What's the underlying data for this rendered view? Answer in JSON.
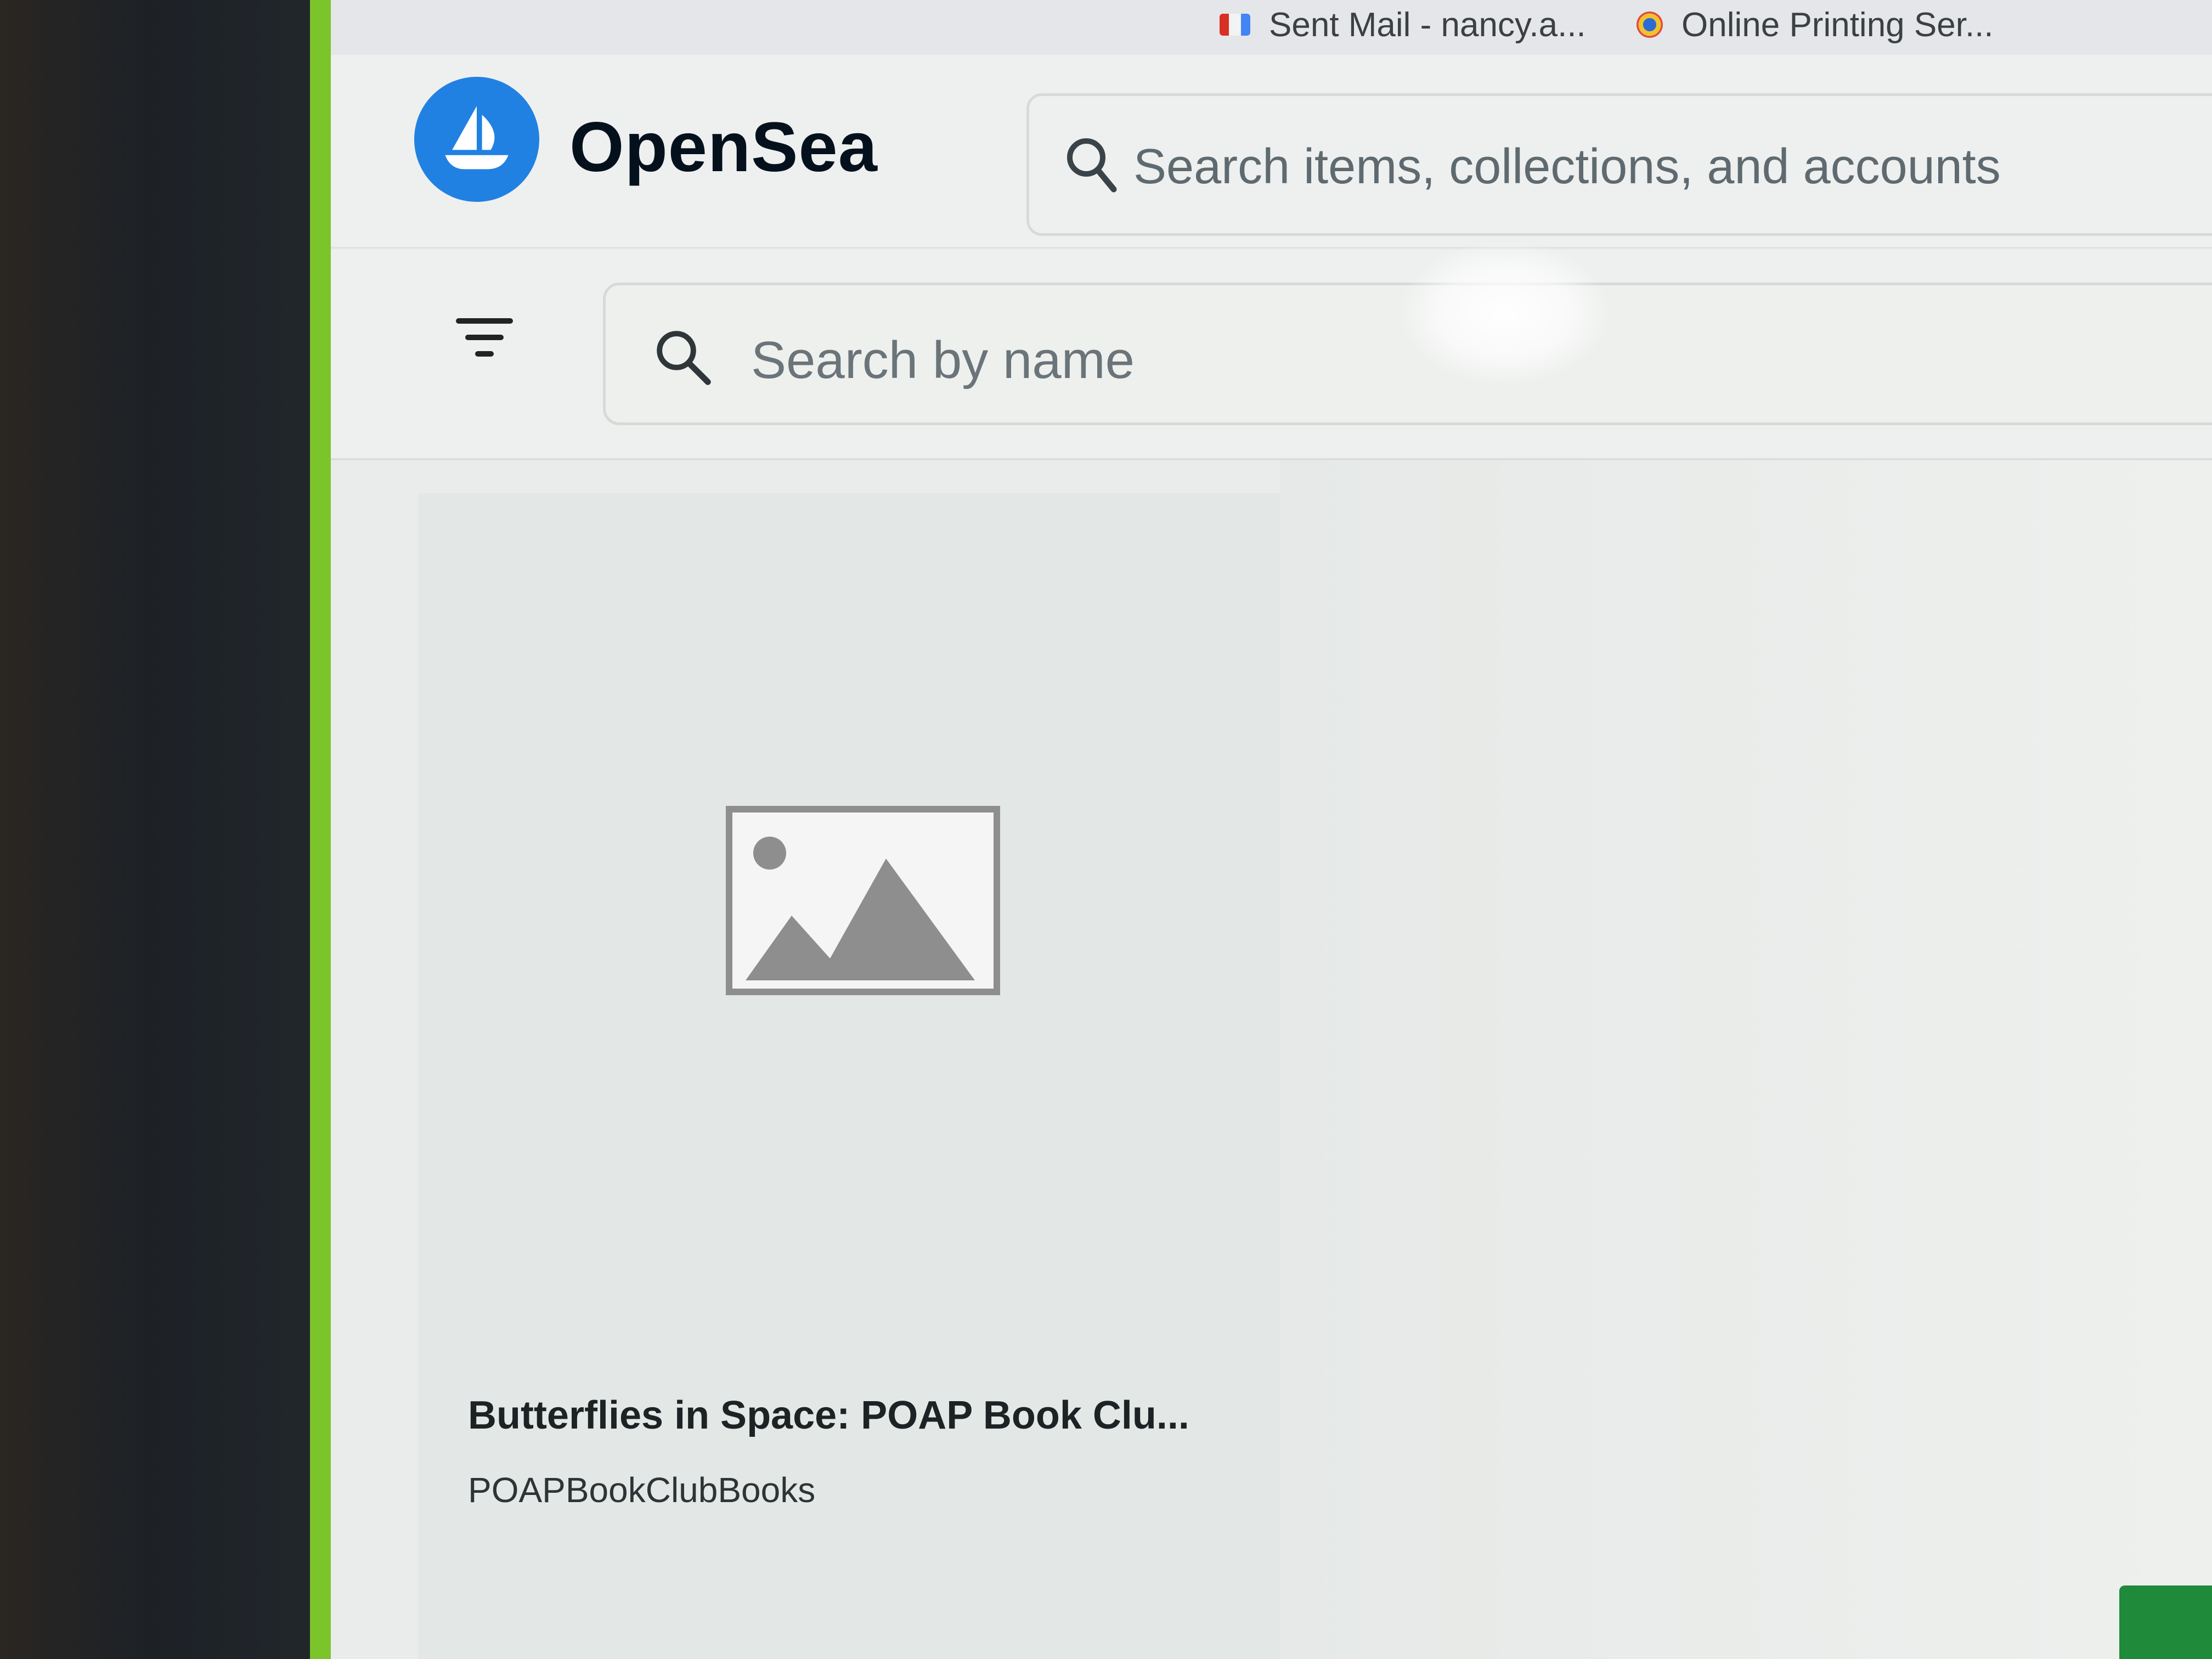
{
  "browser": {
    "bookmarks": [
      {
        "icon": "gmail-icon",
        "label": "Sent Mail - nancy.a..."
      },
      {
        "icon": "printing-service-icon",
        "label": "Online Printing Ser..."
      }
    ]
  },
  "header": {
    "brand": "OpenSea",
    "search_placeholder": "Search items, collections, and accounts"
  },
  "toolbar": {
    "filter_icon": "filter-icon",
    "search_placeholder": "Search by name"
  },
  "items": [
    {
      "title": "Butterflies in Space: POAP Book Clu...",
      "collection": "POAPBookClubBooks",
      "media_icon": "image-placeholder-icon"
    }
  ],
  "colors": {
    "brand_blue": "#2081e2",
    "frame_green": "#7bc42a"
  }
}
